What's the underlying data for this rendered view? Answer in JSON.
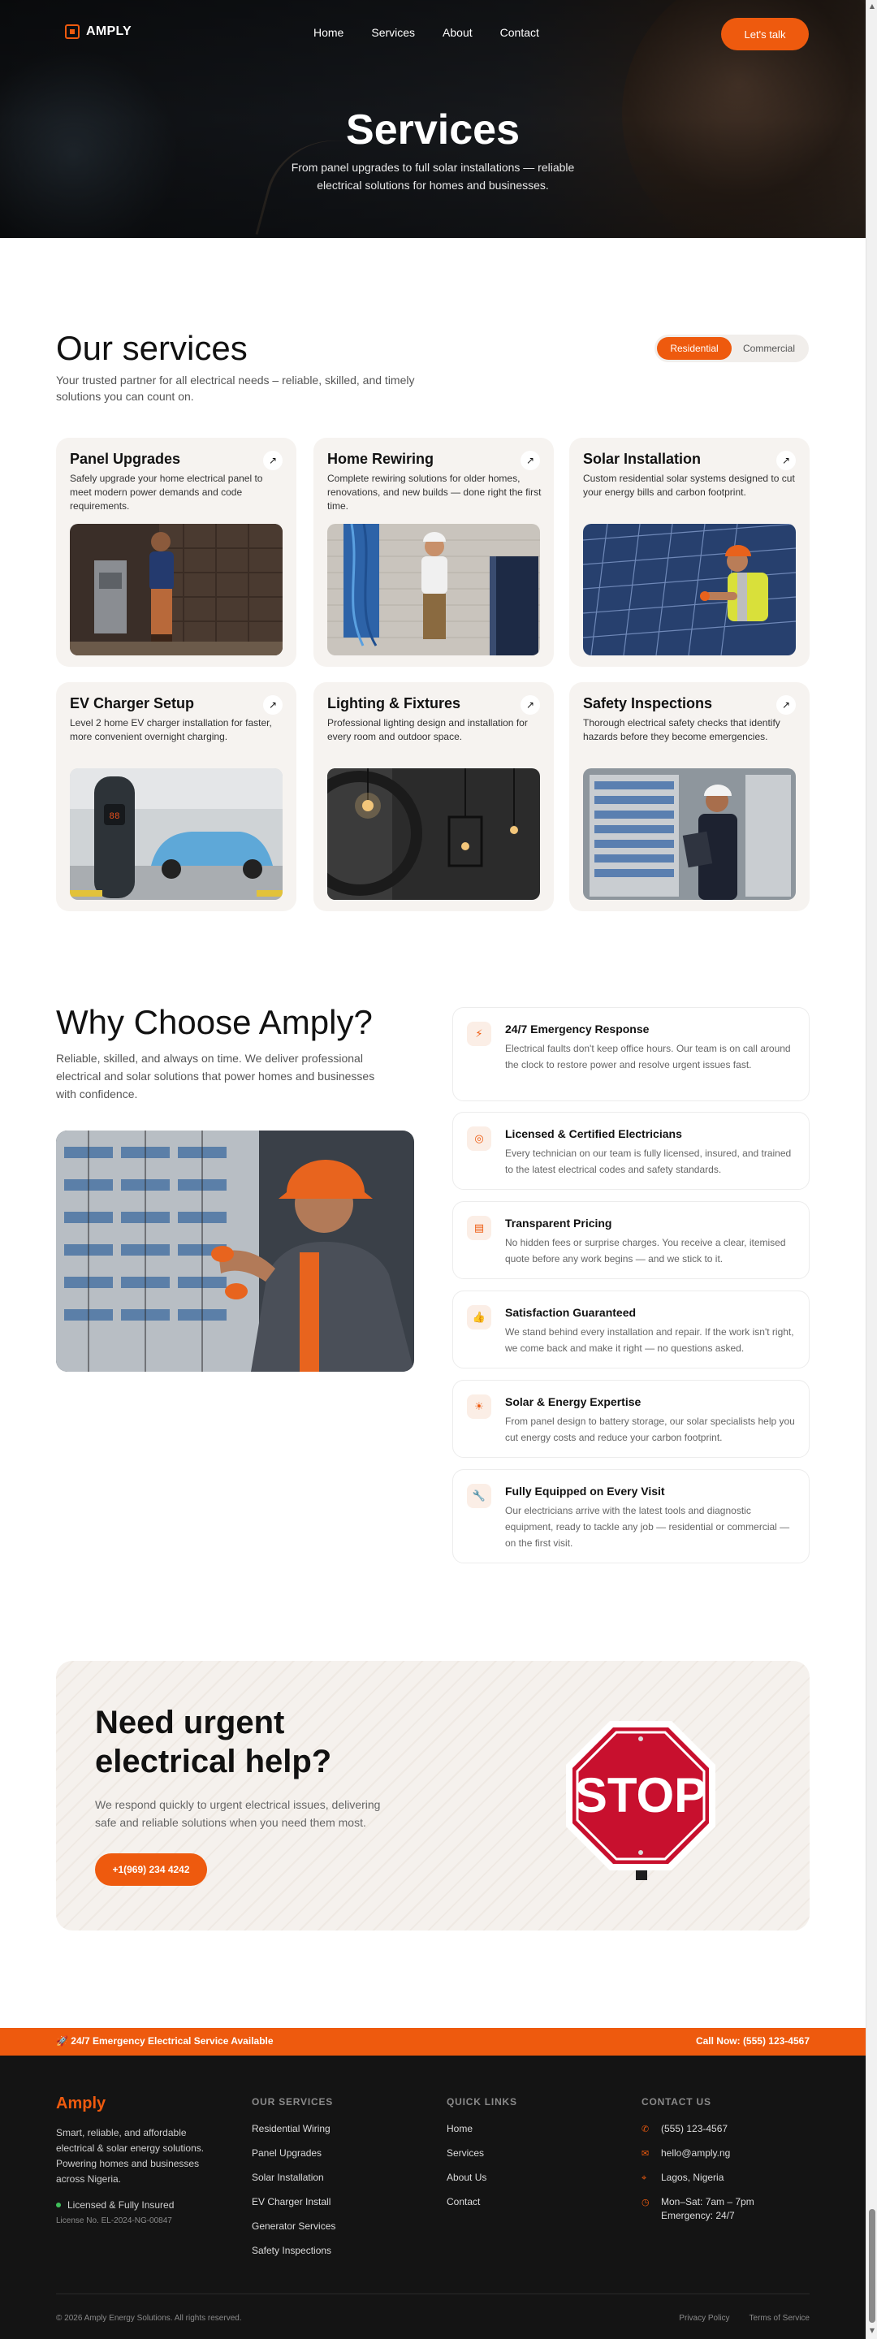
{
  "nav": {
    "brand": "AMPLY",
    "links": [
      "Home",
      "Services",
      "About",
      "Contact"
    ],
    "cta": "Let's talk"
  },
  "hero": {
    "title": "Services",
    "subtitle": "From panel upgrades to full solar installations — reliable electrical solutions for homes and businesses."
  },
  "services": {
    "title": "Our services",
    "subtitle": "Your trusted partner for all electrical needs – reliable, skilled, and timely solutions you can count on.",
    "toggle": [
      "Residential",
      "Commercial"
    ],
    "cards": [
      {
        "title": "Panel Upgrades",
        "desc": "Safely upgrade your home electrical panel to meet modern power demands and code requirements.",
        "icon": "arrow-up-right-icon"
      },
      {
        "title": "Home Rewiring",
        "desc": "Complete rewiring solutions for older homes, renovations, and new builds — done right the first time.",
        "icon": "arrow-up-right-icon"
      },
      {
        "title": "Solar Installation",
        "desc": "Custom residential solar systems designed to cut your energy bills and carbon footprint.",
        "icon": "arrow-up-right-icon"
      },
      {
        "title": "EV Charger Setup",
        "desc": "Level 2 home EV charger installation for faster, more convenient overnight charging.",
        "icon": "arrow-up-right-icon"
      },
      {
        "title": "Lighting & Fixtures",
        "desc": "Professional lighting design and installation for every room and outdoor space.",
        "icon": "arrow-up-right-icon"
      },
      {
        "title": "Safety Inspections",
        "desc": "Thorough electrical safety checks that identify hazards before they become emergencies.",
        "icon": "arrow-up-right-icon"
      }
    ]
  },
  "why": {
    "title": "Why Choose Amply?",
    "subtitle": "Reliable, skilled, and always on time. We deliver professional electrical and solar solutions that power homes and businesses with confidence.",
    "features": [
      {
        "title": "24/7 Emergency Response",
        "desc": "Electrical faults don't keep office hours. Our team is on call around the clock to restore power and resolve urgent issues fast.",
        "icon": "lightning-icon"
      },
      {
        "title": "Licensed & Certified Electricians",
        "desc": "Every technician on our team is fully licensed, insured, and trained to the latest electrical codes and safety standards.",
        "icon": "badge-check-icon"
      },
      {
        "title": "Transparent Pricing",
        "desc": "No hidden fees or surprise charges. You receive a clear, itemised quote before any work begins — and we stick to it.",
        "icon": "receipt-icon"
      },
      {
        "title": "Satisfaction Guaranteed",
        "desc": "We stand behind every installation and repair. If the work isn't right, we come back and make it right — no questions asked.",
        "icon": "thumbs-up-icon"
      },
      {
        "title": "Solar & Energy Expertise",
        "desc": "From panel design to battery storage, our solar specialists help you cut energy costs and reduce your carbon footprint.",
        "icon": "sun-icon"
      },
      {
        "title": "Fully Equipped on Every Visit",
        "desc": "Our electricians arrive with the latest tools and diagnostic equipment, ready to tackle any job — residential or commercial — on the first visit.",
        "icon": "wrench-icon"
      }
    ]
  },
  "cta": {
    "title": "Need urgent electrical help?",
    "subtitle": "We respond quickly to urgent electrical issues, delivering safe and reliable solutions when you need them most.",
    "button": "+1(969) 234 4242",
    "sign_text": "STOP"
  },
  "emergency_bar": {
    "left": "🚀 24/7 Emergency Electrical Service Available",
    "right": "Call Now: (555) 123-4567"
  },
  "footer": {
    "brand": "Amply",
    "about": "Smart, reliable, and affordable electrical & solar energy solutions. Powering homes and businesses across Nigeria.",
    "licensed": "Licensed & Fully Insured",
    "license_no": "License No. EL-2024-NG-00847",
    "services_head": "OUR SERVICES",
    "services": [
      "Residential Wiring",
      "Panel Upgrades",
      "Solar Installation",
      "EV Charger Install",
      "Generator Services",
      "Safety Inspections"
    ],
    "links_head": "QUICK LINKS",
    "links": [
      "Home",
      "Services",
      "About Us",
      "Contact"
    ],
    "contact_head": "CONTACT US",
    "contact": {
      "phone": "(555) 123-4567",
      "email": "hello@amply.ng",
      "location": "Lagos, Nigeria",
      "hours_1": "Mon–Sat: 7am – 7pm",
      "hours_2": "Emergency: 24/7"
    },
    "copyright": "© 2026 Amply Energy Solutions. All rights reserved.",
    "bottom_links": [
      "Privacy Policy",
      "Terms of Service"
    ]
  },
  "colors": {
    "accent": "#ee5a0e",
    "dark": "#141414",
    "card": "#f6f3f0"
  }
}
